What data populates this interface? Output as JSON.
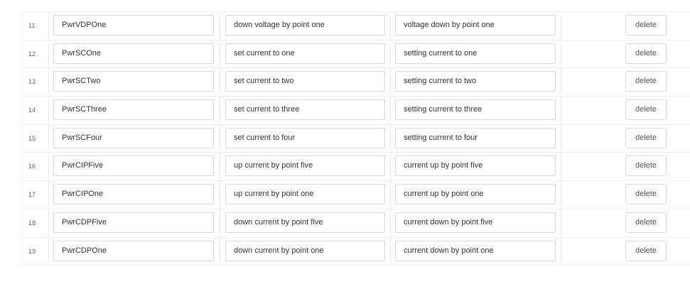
{
  "rows": [
    {
      "index": "11",
      "name": "PwrVDPOne",
      "command": "down voltage by point one",
      "response": "voltage down by point one",
      "delete_label": "delete"
    },
    {
      "index": "12",
      "name": "PwrSCOne",
      "command": "set current to one",
      "response": "setting current to one",
      "delete_label": "delete"
    },
    {
      "index": "13",
      "name": "PwrSCTwo",
      "command": "set current to two",
      "response": "setting current to two",
      "delete_label": "delete"
    },
    {
      "index": "14",
      "name": "PwrSCThree",
      "command": "set current to three",
      "response": "setting current to three",
      "delete_label": "delete"
    },
    {
      "index": "15",
      "name": "PwrSCFour",
      "command": "set current to four",
      "response": "setting current to four",
      "delete_label": "delete"
    },
    {
      "index": "16",
      "name": "PwrCIPFive",
      "command": "up current by point five",
      "response": "current up by point five",
      "delete_label": "delete"
    },
    {
      "index": "17",
      "name": "PwrCIPOne",
      "command": "up current by point one",
      "response": "current up by point one",
      "delete_label": "delete"
    },
    {
      "index": "18",
      "name": "PwrCDPFive",
      "command": "down current by point five",
      "response": "current down by point five",
      "delete_label": "delete"
    },
    {
      "index": "19",
      "name": "PwrCDPOne",
      "command": "down current by point one",
      "response": "current down by point one",
      "delete_label": "delete"
    }
  ]
}
